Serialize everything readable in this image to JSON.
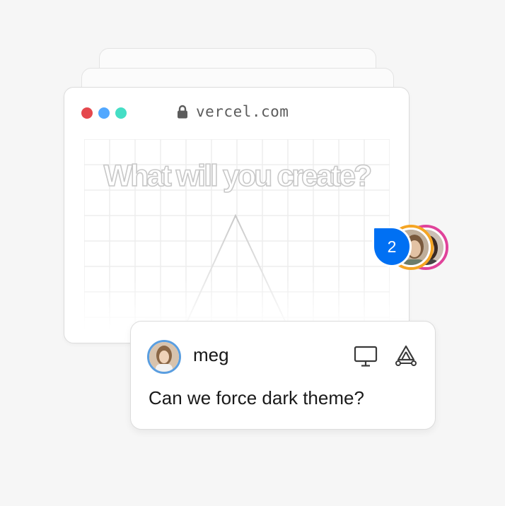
{
  "browser": {
    "traffic_lights": {
      "close_color": "#e5484d",
      "minimize_color": "#52a8ff",
      "maximize_color": "#45dec5"
    },
    "url": "vercel.com",
    "headline": "What will you create?"
  },
  "collaborators": {
    "count": "2",
    "bubble_color": "#0070f3",
    "ring_colors": [
      "#f5a524",
      "#e0439a"
    ]
  },
  "comment": {
    "user": "meg",
    "text": "Can we force dark theme?",
    "icons": [
      "desktop-icon",
      "vercel-toolbar-icon"
    ],
    "avatar_ring_color": "#5a9ee0"
  }
}
